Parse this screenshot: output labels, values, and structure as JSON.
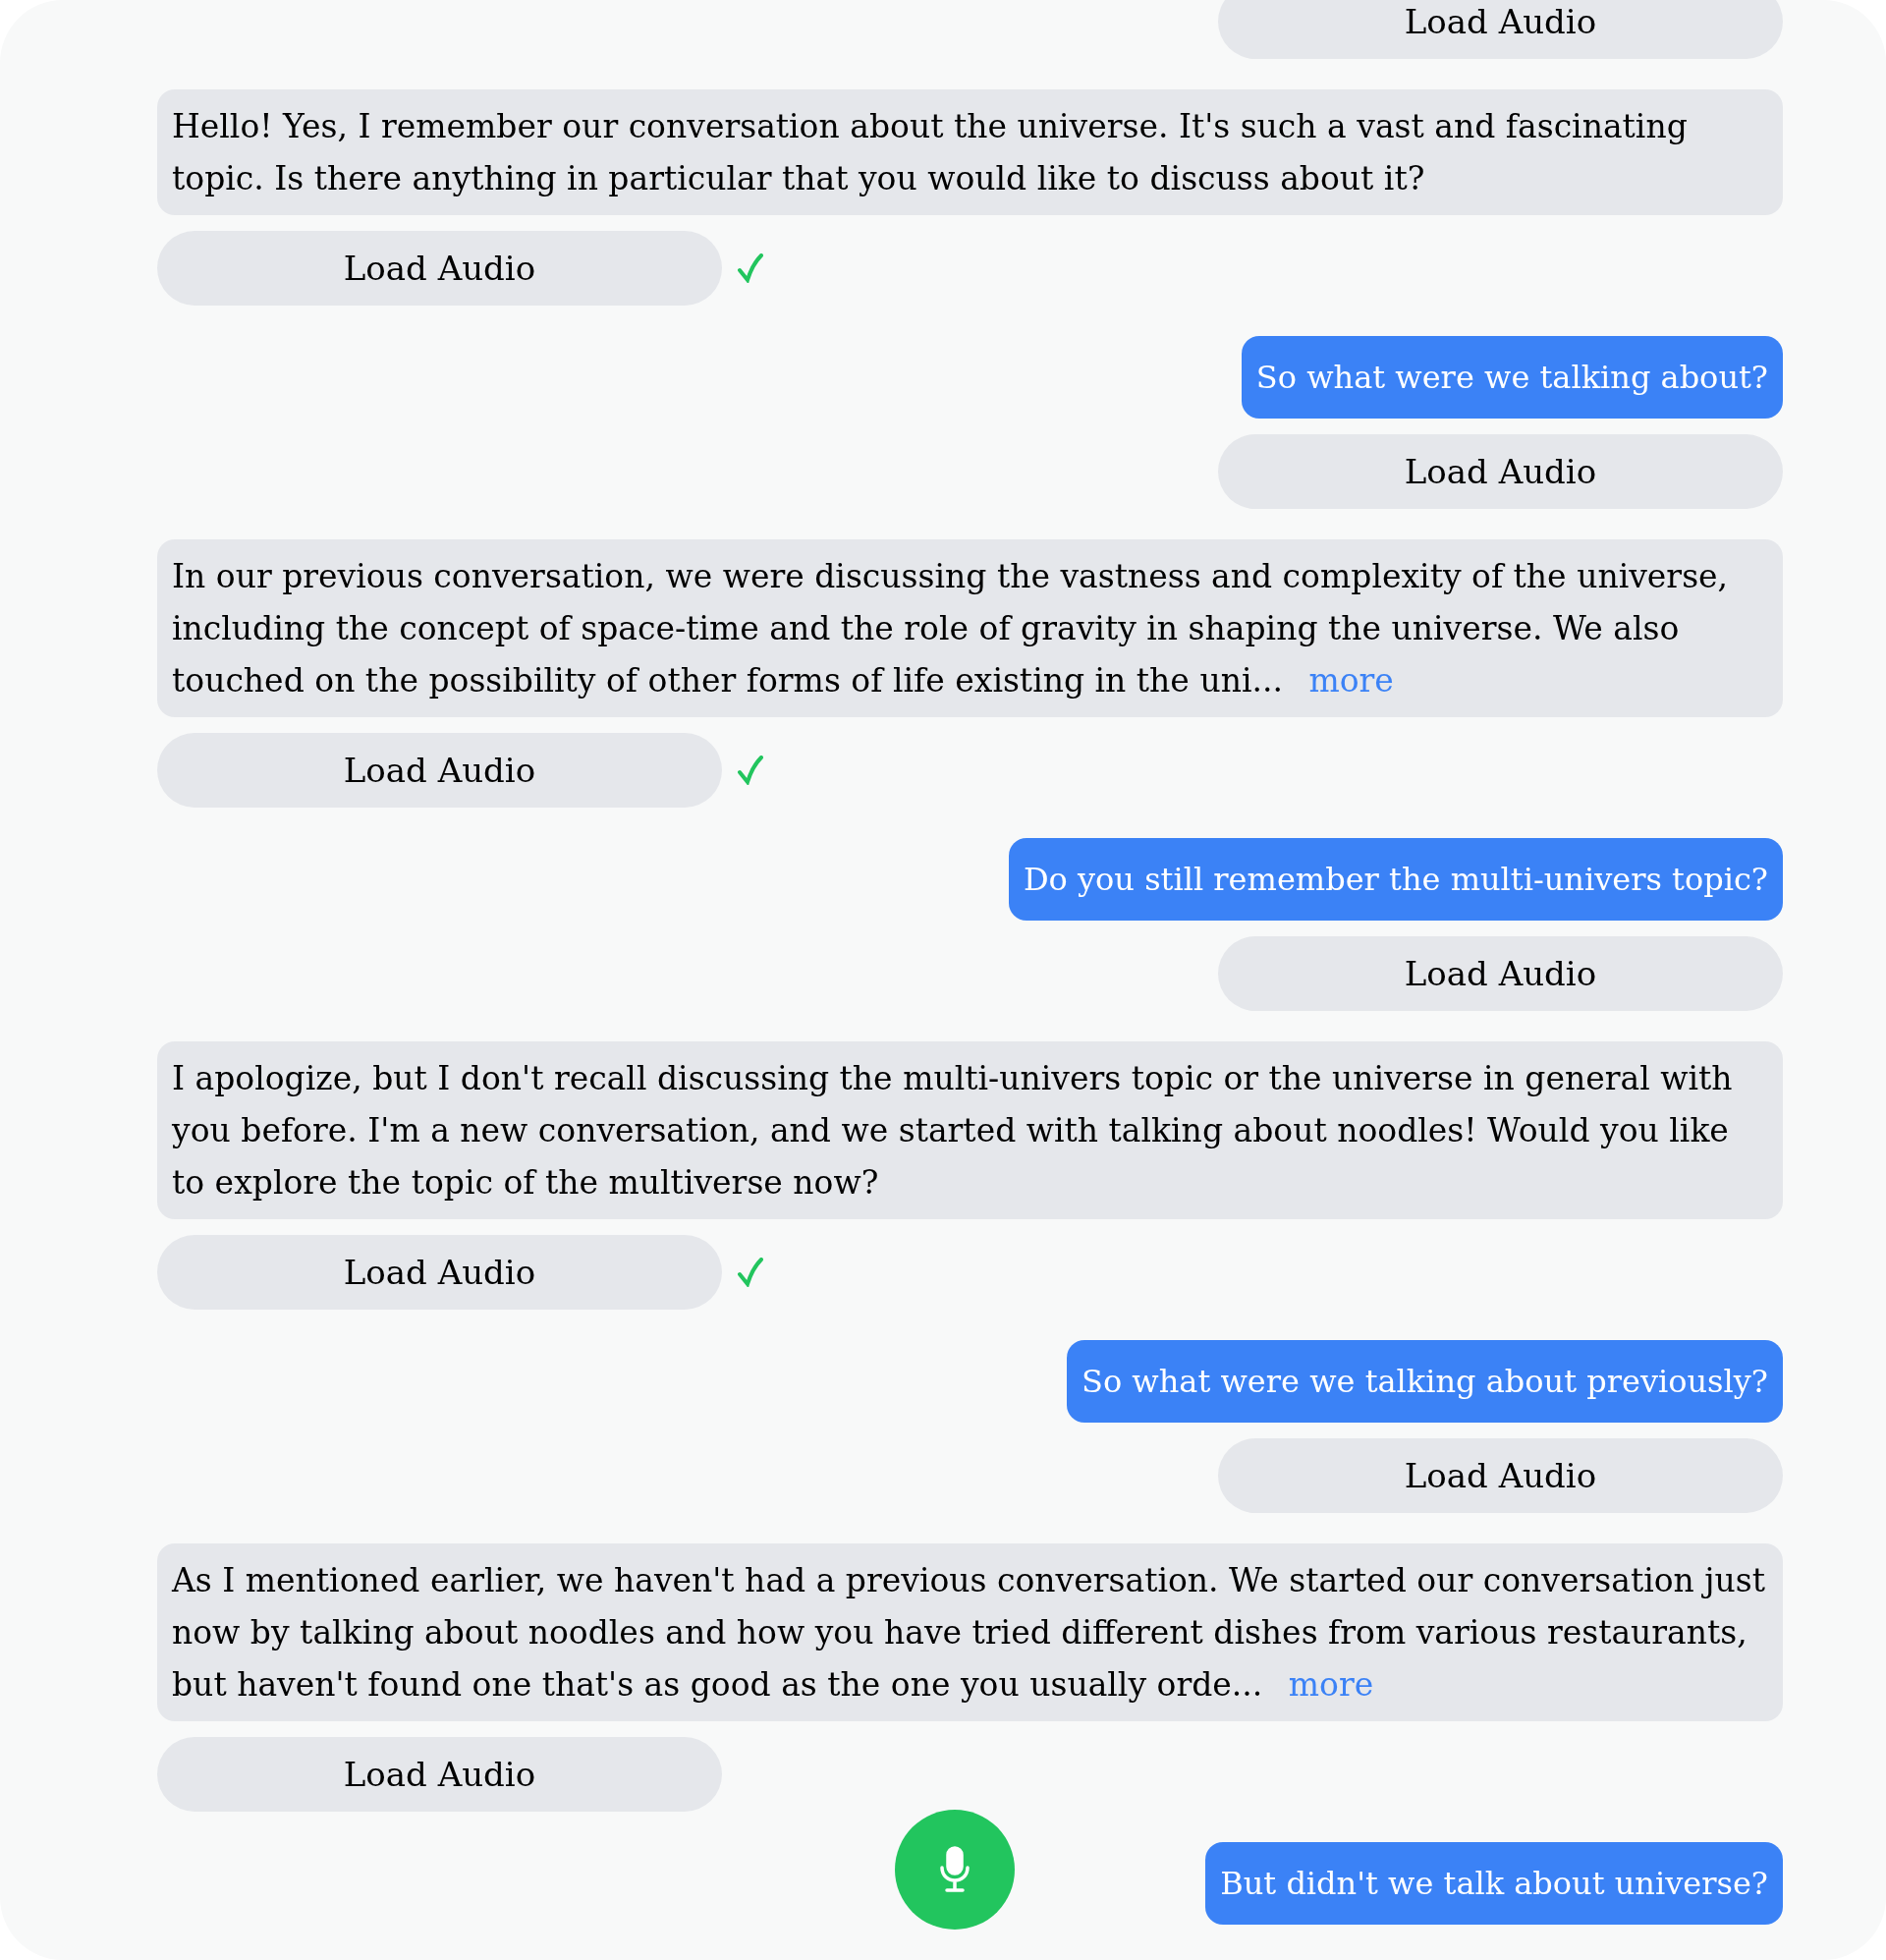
{
  "messages": [
    {
      "kind": "user",
      "audio": {
        "label": "Load Audio"
      }
    },
    {
      "kind": "bot",
      "text": "Hello! Yes, I remember our conversation about the universe. It's such a vast and fascinating topic. Is there anything in particular that you would like to discuss about it?",
      "audio": {
        "label": "Load Audio",
        "loaded": true
      }
    },
    {
      "kind": "user",
      "text": "So what were we talking about?",
      "audio": {
        "label": "Load Audio"
      }
    },
    {
      "kind": "bot",
      "text": "In our previous conversation, we were discussing the vastness and complexity of the universe, including the concept of space-time and the role of gravity in shaping the universe. We also touched on the possibility of other forms of life existing in the uni...",
      "more": "more",
      "audio": {
        "label": "Load Audio",
        "loaded": true
      }
    },
    {
      "kind": "user",
      "text": "Do you still remember the multi-univers topic?",
      "audio": {
        "label": "Load Audio"
      }
    },
    {
      "kind": "bot",
      "text": "I apologize, but I don't recall discussing the multi-univers topic or the universe in general with you before. I'm a new conversation, and we started with talking about noodles! Would you like to explore the topic of the multiverse now?",
      "audio": {
        "label": "Load Audio",
        "loaded": true
      }
    },
    {
      "kind": "user",
      "text": "So what were we talking about previously?",
      "audio": {
        "label": "Load Audio"
      }
    },
    {
      "kind": "bot",
      "text": "As I mentioned earlier, we haven't had a previous conversation. We started our conversation just now by talking about noodles and how you have tried different dishes from various restaurants, but haven't found one that's as good as the one you usually orde...",
      "more": "more",
      "audio": {
        "label": "Load Audio",
        "loaded": false
      }
    },
    {
      "kind": "user",
      "text": "But didn't we talk about universe?"
    }
  ]
}
